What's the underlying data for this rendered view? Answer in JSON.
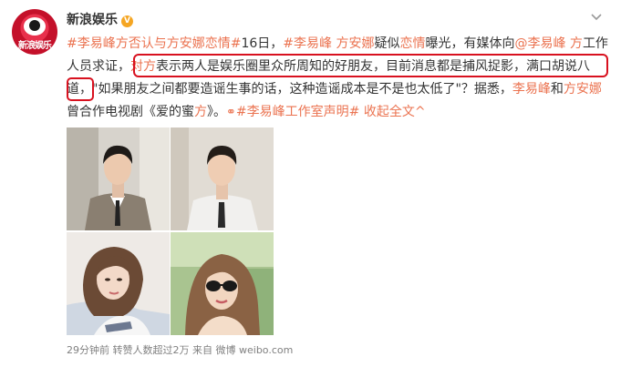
{
  "account": {
    "name": "新浪娱乐",
    "avatar_text": "新浪娱乐",
    "verified_mark": "V"
  },
  "post": {
    "tag1": "#李易峰方否认与方安娜恋情#",
    "t1": "16日，",
    "tag2": "#李易峰 方安娜",
    "t2": "疑似",
    "kw_romance": "恋情",
    "t3": "曝光，有媒体向",
    "mention1": "@李易峰 方",
    "t4": "工作人员求证，",
    "kw_dui": "对方",
    "t5": "表示两人是娱乐圈里众所周知的好朋友，目前消息都是捕风捉影，满口胡说八道，",
    "t6": "\"如果朋友之间都要造谣生事的话，这种造谣成本是不是也太低了\"？据悉，",
    "name1": "李易峰",
    "t7": "和",
    "name2": "方安娜",
    "t8": "曾合作电视剧《爱的蜜",
    "t8b": "方",
    "t8c": "》。",
    "tag3": "#李易峰工作室声明#",
    "collapse": "收起全文",
    "collapse_arrow": "^"
  },
  "meta": {
    "time": "29分钟前",
    "reposts": "转赞人数超过2万",
    "source": "来自 微博 weibo.com"
  },
  "colors": {
    "link": "#eb7350",
    "highlight_box": "#d8111f",
    "text": "#333333",
    "meta": "#808080"
  },
  "icons": [
    "verified-icon",
    "chevron-down-icon",
    "link-icon"
  ]
}
